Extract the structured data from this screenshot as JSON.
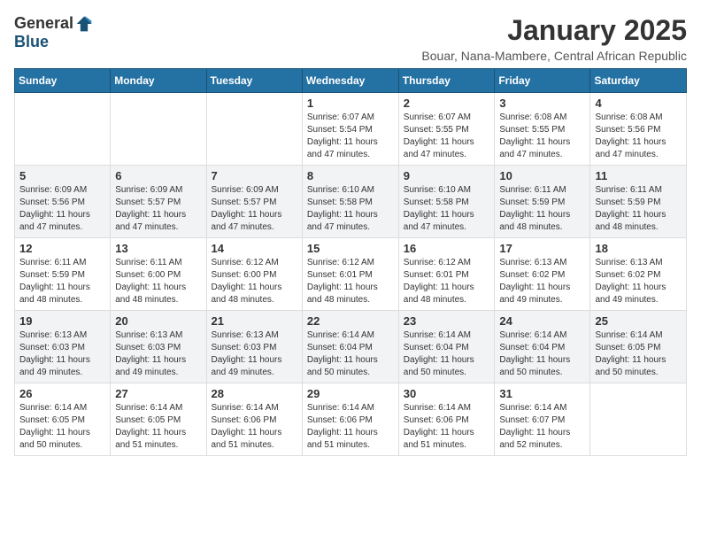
{
  "logo": {
    "general": "General",
    "blue": "Blue"
  },
  "title": "January 2025",
  "location": "Bouar, Nana-Mambere, Central African Republic",
  "days_of_week": [
    "Sunday",
    "Monday",
    "Tuesday",
    "Wednesday",
    "Thursday",
    "Friday",
    "Saturday"
  ],
  "weeks": [
    [
      {
        "day": "",
        "info": ""
      },
      {
        "day": "",
        "info": ""
      },
      {
        "day": "",
        "info": ""
      },
      {
        "day": "1",
        "info": "Sunrise: 6:07 AM\nSunset: 5:54 PM\nDaylight: 11 hours and 47 minutes."
      },
      {
        "day": "2",
        "info": "Sunrise: 6:07 AM\nSunset: 5:55 PM\nDaylight: 11 hours and 47 minutes."
      },
      {
        "day": "3",
        "info": "Sunrise: 6:08 AM\nSunset: 5:55 PM\nDaylight: 11 hours and 47 minutes."
      },
      {
        "day": "4",
        "info": "Sunrise: 6:08 AM\nSunset: 5:56 PM\nDaylight: 11 hours and 47 minutes."
      }
    ],
    [
      {
        "day": "5",
        "info": "Sunrise: 6:09 AM\nSunset: 5:56 PM\nDaylight: 11 hours and 47 minutes."
      },
      {
        "day": "6",
        "info": "Sunrise: 6:09 AM\nSunset: 5:57 PM\nDaylight: 11 hours and 47 minutes."
      },
      {
        "day": "7",
        "info": "Sunrise: 6:09 AM\nSunset: 5:57 PM\nDaylight: 11 hours and 47 minutes."
      },
      {
        "day": "8",
        "info": "Sunrise: 6:10 AM\nSunset: 5:58 PM\nDaylight: 11 hours and 47 minutes."
      },
      {
        "day": "9",
        "info": "Sunrise: 6:10 AM\nSunset: 5:58 PM\nDaylight: 11 hours and 47 minutes."
      },
      {
        "day": "10",
        "info": "Sunrise: 6:11 AM\nSunset: 5:59 PM\nDaylight: 11 hours and 48 minutes."
      },
      {
        "day": "11",
        "info": "Sunrise: 6:11 AM\nSunset: 5:59 PM\nDaylight: 11 hours and 48 minutes."
      }
    ],
    [
      {
        "day": "12",
        "info": "Sunrise: 6:11 AM\nSunset: 5:59 PM\nDaylight: 11 hours and 48 minutes."
      },
      {
        "day": "13",
        "info": "Sunrise: 6:11 AM\nSunset: 6:00 PM\nDaylight: 11 hours and 48 minutes."
      },
      {
        "day": "14",
        "info": "Sunrise: 6:12 AM\nSunset: 6:00 PM\nDaylight: 11 hours and 48 minutes."
      },
      {
        "day": "15",
        "info": "Sunrise: 6:12 AM\nSunset: 6:01 PM\nDaylight: 11 hours and 48 minutes."
      },
      {
        "day": "16",
        "info": "Sunrise: 6:12 AM\nSunset: 6:01 PM\nDaylight: 11 hours and 48 minutes."
      },
      {
        "day": "17",
        "info": "Sunrise: 6:13 AM\nSunset: 6:02 PM\nDaylight: 11 hours and 49 minutes."
      },
      {
        "day": "18",
        "info": "Sunrise: 6:13 AM\nSunset: 6:02 PM\nDaylight: 11 hours and 49 minutes."
      }
    ],
    [
      {
        "day": "19",
        "info": "Sunrise: 6:13 AM\nSunset: 6:03 PM\nDaylight: 11 hours and 49 minutes."
      },
      {
        "day": "20",
        "info": "Sunrise: 6:13 AM\nSunset: 6:03 PM\nDaylight: 11 hours and 49 minutes."
      },
      {
        "day": "21",
        "info": "Sunrise: 6:13 AM\nSunset: 6:03 PM\nDaylight: 11 hours and 49 minutes."
      },
      {
        "day": "22",
        "info": "Sunrise: 6:14 AM\nSunset: 6:04 PM\nDaylight: 11 hours and 50 minutes."
      },
      {
        "day": "23",
        "info": "Sunrise: 6:14 AM\nSunset: 6:04 PM\nDaylight: 11 hours and 50 minutes."
      },
      {
        "day": "24",
        "info": "Sunrise: 6:14 AM\nSunset: 6:04 PM\nDaylight: 11 hours and 50 minutes."
      },
      {
        "day": "25",
        "info": "Sunrise: 6:14 AM\nSunset: 6:05 PM\nDaylight: 11 hours and 50 minutes."
      }
    ],
    [
      {
        "day": "26",
        "info": "Sunrise: 6:14 AM\nSunset: 6:05 PM\nDaylight: 11 hours and 50 minutes."
      },
      {
        "day": "27",
        "info": "Sunrise: 6:14 AM\nSunset: 6:05 PM\nDaylight: 11 hours and 51 minutes."
      },
      {
        "day": "28",
        "info": "Sunrise: 6:14 AM\nSunset: 6:06 PM\nDaylight: 11 hours and 51 minutes."
      },
      {
        "day": "29",
        "info": "Sunrise: 6:14 AM\nSunset: 6:06 PM\nDaylight: 11 hours and 51 minutes."
      },
      {
        "day": "30",
        "info": "Sunrise: 6:14 AM\nSunset: 6:06 PM\nDaylight: 11 hours and 51 minutes."
      },
      {
        "day": "31",
        "info": "Sunrise: 6:14 AM\nSunset: 6:07 PM\nDaylight: 11 hours and 52 minutes."
      },
      {
        "day": "",
        "info": ""
      }
    ]
  ]
}
